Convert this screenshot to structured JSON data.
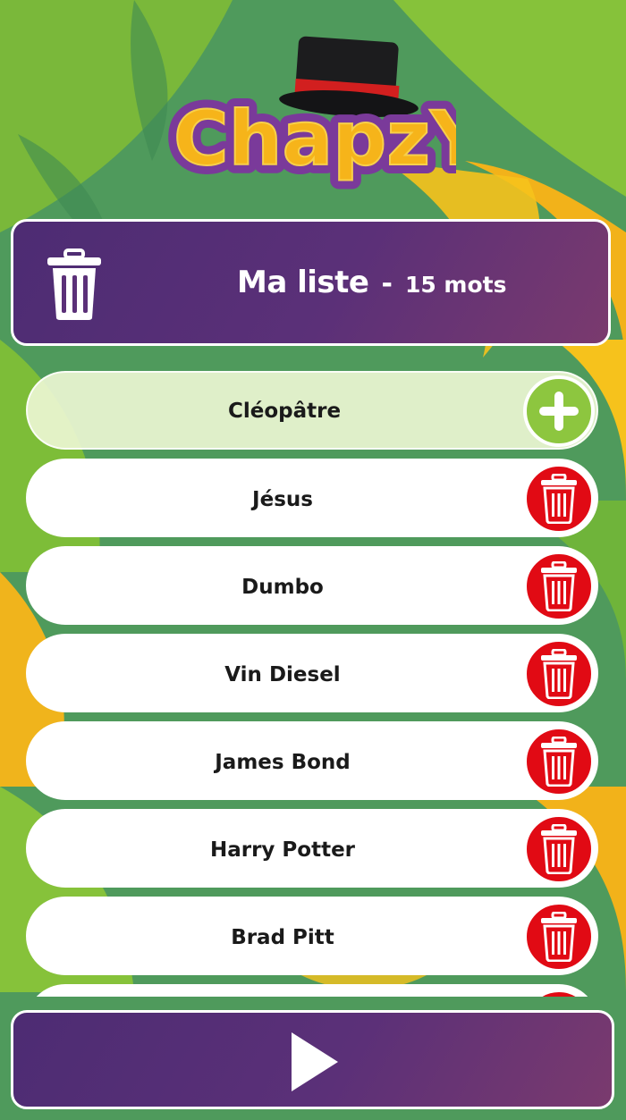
{
  "app": {
    "logo_text": "ChapzY"
  },
  "header": {
    "title": "Ma liste",
    "separator": "-",
    "count": "15 mots",
    "delete_all_icon": "trash-icon"
  },
  "input": {
    "value": "Cléopâtre",
    "add_icon": "plus-icon"
  },
  "words": [
    "Jésus",
    "Dumbo",
    "Vin Diesel",
    "James Bond",
    "Harry Potter",
    "Brad Pitt",
    ""
  ],
  "footer": {
    "play_icon": "play-icon"
  },
  "colors": {
    "purple": "#5b3078",
    "delete_red": "#e10a14",
    "add_green": "#8dc63f",
    "background_green": "#4f9a5c"
  }
}
